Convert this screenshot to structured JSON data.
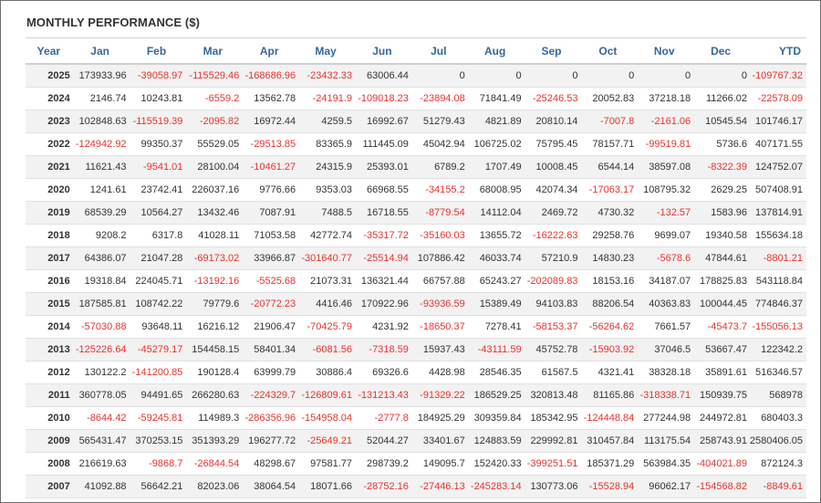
{
  "panel": {
    "title": "MONTHLY PERFORMANCE ($)"
  },
  "columns": [
    "Year",
    "Jan",
    "Feb",
    "Mar",
    "Apr",
    "May",
    "Jun",
    "Jul",
    "Aug",
    "Sep",
    "Oct",
    "Nov",
    "Dec",
    "YTD"
  ],
  "colors": {
    "header_text": "#35679b",
    "negative": "#e8322c",
    "text": "#333333",
    "stripe": "#f2f2f2"
  },
  "rows": [
    [
      "2025",
      "173933.96",
      "-39058.97",
      "-115529.46",
      "-168686.96",
      "-23432.33",
      "63006.44",
      "0",
      "0",
      "0",
      "0",
      "0",
      "0",
      "-109767.32"
    ],
    [
      "2024",
      "2146.74",
      "10243.81",
      "-6559.2",
      "13562.78",
      "-24191.9",
      "-109018.23",
      "-23894.08",
      "71841.49",
      "-25246.53",
      "20052.83",
      "37218.18",
      "11266.02",
      "-22578.09"
    ],
    [
      "2023",
      "102848.63",
      "-115519.39",
      "-2095.82",
      "16972.44",
      "4259.5",
      "16992.67",
      "51279.43",
      "4821.89",
      "20810.14",
      "-7007.8",
      "-2161.06",
      "10545.54",
      "101746.17"
    ],
    [
      "2022",
      "-124942.92",
      "99350.37",
      "55529.05",
      "-29513.85",
      "83365.9",
      "111445.09",
      "45042.94",
      "106725.02",
      "75795.45",
      "78157.71",
      "-99519.81",
      "5736.6",
      "407171.55"
    ],
    [
      "2021",
      "11621.43",
      "-9541.01",
      "28100.04",
      "-10461.27",
      "24315.9",
      "25393.01",
      "6789.2",
      "1707.49",
      "10008.45",
      "6544.14",
      "38597.08",
      "-8322.39",
      "124752.07"
    ],
    [
      "2020",
      "1241.61",
      "23742.41",
      "226037.16",
      "9776.66",
      "9353.03",
      "66968.55",
      "-34155.2",
      "68008.95",
      "42074.34",
      "-17063.17",
      "108795.32",
      "2629.25",
      "507408.91"
    ],
    [
      "2019",
      "68539.29",
      "10564.27",
      "13432.46",
      "7087.91",
      "7488.5",
      "16718.55",
      "-8779.54",
      "14112.04",
      "2469.72",
      "4730.32",
      "-132.57",
      "1583.96",
      "137814.91"
    ],
    [
      "2018",
      "9208.2",
      "6317.8",
      "41028.11",
      "71053.58",
      "42772.74",
      "-35317.72",
      "-35160.03",
      "13655.72",
      "-16222.63",
      "29258.76",
      "9699.07",
      "19340.58",
      "155634.18"
    ],
    [
      "2017",
      "64386.07",
      "21047.28",
      "-69173.02",
      "33966.87",
      "-301640.77",
      "-25514.94",
      "107886.42",
      "46033.74",
      "57210.9",
      "14830.23",
      "-5678.6",
      "47844.61",
      "-8801.21"
    ],
    [
      "2016",
      "19318.84",
      "224045.71",
      "-13192.16",
      "-5525.68",
      "21073.31",
      "136321.44",
      "66757.88",
      "65243.27",
      "-202089.83",
      "18153.16",
      "34187.07",
      "178825.83",
      "543118.84"
    ],
    [
      "2015",
      "187585.81",
      "108742.22",
      "79779.6",
      "-20772.23",
      "4416.46",
      "170922.96",
      "-93936.59",
      "15389.49",
      "94103.83",
      "88206.54",
      "40363.83",
      "100044.45",
      "774846.37"
    ],
    [
      "2014",
      "-57030.88",
      "93648.11",
      "16216.12",
      "21906.47",
      "-70425.79",
      "4231.92",
      "-18650.37",
      "7278.41",
      "-58153.37",
      "-56264.62",
      "7661.57",
      "-45473.7",
      "-155056.13"
    ],
    [
      "2013",
      "-125226.64",
      "-45279.17",
      "154458.15",
      "58401.34",
      "-6081.56",
      "-7318.59",
      "15937.43",
      "-43111.59",
      "45752.78",
      "-15903.92",
      "37046.5",
      "53667.47",
      "122342.2"
    ],
    [
      "2012",
      "130122.2",
      "-141200.85",
      "190128.4",
      "63999.79",
      "30886.4",
      "69326.6",
      "4428.98",
      "28546.35",
      "61567.5",
      "4321.41",
      "38328.18",
      "35891.61",
      "516346.57"
    ],
    [
      "2011",
      "360778.05",
      "94491.65",
      "266280.63",
      "-224329.7",
      "-126809.61",
      "-131213.43",
      "-91329.22",
      "186529.25",
      "320813.48",
      "81165.86",
      "-318338.71",
      "150939.75",
      "568978"
    ],
    [
      "2010",
      "-8644.42",
      "-59245.81",
      "114989.3",
      "-286356.96",
      "-154958.04",
      "-2777.8",
      "184925.29",
      "309359.84",
      "185342.95",
      "-124448.84",
      "277244.98",
      "244972.81",
      "680403.3"
    ],
    [
      "2009",
      "565431.47",
      "370253.15",
      "351393.29",
      "196277.72",
      "-25649.21",
      "52044.27",
      "33401.67",
      "124883.59",
      "229992.81",
      "310457.84",
      "113175.54",
      "258743.91",
      "2580406.05"
    ],
    [
      "2008",
      "216619.63",
      "-9868.7",
      "-26844.54",
      "48298.67",
      "97581.77",
      "298739.2",
      "149095.7",
      "152420.33",
      "-399251.51",
      "185371.29",
      "563984.35",
      "-404021.89",
      "872124.3"
    ],
    [
      "2007",
      "41092.88",
      "56642.21",
      "82023.06",
      "38064.54",
      "18071.66",
      "-28752.16",
      "-27446.13",
      "-245283.14",
      "130773.06",
      "-15528.94",
      "96062.17",
      "-154568.82",
      "-8849.61"
    ]
  ]
}
